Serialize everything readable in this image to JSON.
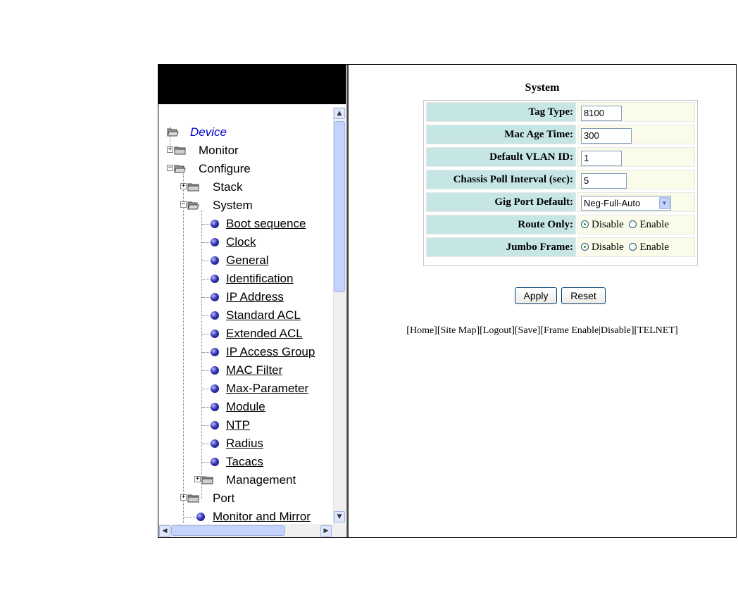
{
  "tree": {
    "root": "Device",
    "items": [
      {
        "label": "Monitor"
      },
      {
        "label": "Configure"
      },
      {
        "label": "Stack"
      },
      {
        "label": "System"
      },
      {
        "label": "Boot sequence"
      },
      {
        "label": "Clock"
      },
      {
        "label": "General"
      },
      {
        "label": "Identification"
      },
      {
        "label": "IP Address"
      },
      {
        "label": "Standard ACL"
      },
      {
        "label": "Extended ACL"
      },
      {
        "label": "IP Access Group"
      },
      {
        "label": "MAC Filter"
      },
      {
        "label": "Max-Parameter"
      },
      {
        "label": "Module"
      },
      {
        "label": "NTP"
      },
      {
        "label": "Radius"
      },
      {
        "label": "Tacacs"
      },
      {
        "label": "Management"
      },
      {
        "label": "Port"
      },
      {
        "label": "Monitor and Mirror"
      }
    ]
  },
  "form": {
    "title": "System",
    "tag_type": {
      "label": "Tag Type:",
      "value": "8100"
    },
    "mac_age": {
      "label": "Mac Age Time:",
      "value": "300"
    },
    "vlan": {
      "label": "Default VLAN ID:",
      "value": "1"
    },
    "poll": {
      "label": "Chassis Poll Interval (sec):",
      "value": "5"
    },
    "gig": {
      "label": "Gig Port Default:",
      "value": "Neg-Full-Auto"
    },
    "route_only": {
      "label": "Route Only:",
      "selected": "Disable"
    },
    "jumbo": {
      "label": "Jumbo Frame:",
      "selected": "Disable"
    },
    "radio_disable": "Disable",
    "radio_enable": "Enable",
    "apply": "Apply",
    "reset": "Reset"
  },
  "nav": {
    "home": "[Home]",
    "sitemap": "[Site Map]",
    "logout": "[Logout]",
    "save": "[Save]",
    "frame_prefix": "[Frame ",
    "enable": "Enable",
    "sep": "|",
    "disable": "Disable",
    "frame_suffix": "]",
    "telnet": "[TELNET]"
  }
}
